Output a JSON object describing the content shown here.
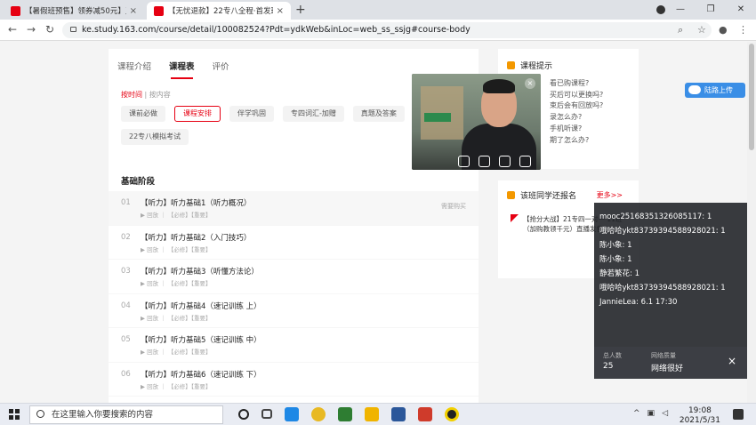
{
  "browser": {
    "tabs": [
      {
        "title": "【暑假班预售】领券减50元】丑",
        "active": false
      },
      {
        "title": "【无忧退款】22专八全程·首发班",
        "active": true
      }
    ],
    "new_tab": "+",
    "url": "ke.study.163.com/course/detail/100082524?Pdt=ydkWeb&inLoc=web_ss_ssjg#course-body"
  },
  "course": {
    "tabs": [
      {
        "label": "课程介绍",
        "active": false
      },
      {
        "label": "课程表",
        "active": true
      },
      {
        "label": "评价",
        "active": false
      }
    ],
    "sort": {
      "time": "按时间",
      "sep": "|",
      "content": "按内容"
    },
    "chips": [
      {
        "label": "课前必做",
        "selected": false
      },
      {
        "label": "课程安排",
        "selected": true
      },
      {
        "label": "伴学巩固",
        "selected": false
      },
      {
        "label": "专四词汇-加赠",
        "selected": false
      },
      {
        "label": "真题及答案",
        "selected": false
      },
      {
        "label": "22专八模拟考试",
        "selected": false
      }
    ],
    "section_title": "基础阶段",
    "lessons": [
      {
        "num": "01",
        "title": "【听力】听力基础1（听力概况）",
        "meta": "▶ 回放 ｜ 【必修】【重要】",
        "right": "需要购买"
      },
      {
        "num": "02",
        "title": "【听力】听力基础2（入门技巧）",
        "meta": "▶ 回放 ｜ 【必修】【重要】",
        "right": ""
      },
      {
        "num": "03",
        "title": "【听力】听力基础3（听懂方法论）",
        "meta": "▶ 回放 ｜ 【必修】【重要】",
        "right": ""
      },
      {
        "num": "04",
        "title": "【听力】听力基础4（速记训练 上）",
        "meta": "▶ 回放 ｜ 【必修】【重要】",
        "right": ""
      },
      {
        "num": "05",
        "title": "【听力】听力基础5（速记训练 中）",
        "meta": "▶ 回放 ｜ 【必修】【重要】",
        "right": ""
      },
      {
        "num": "06",
        "title": "【听力】听力基础6（速记训练 下）",
        "meta": "▶ 回放 ｜ 【必修】【重要】",
        "right": ""
      }
    ]
  },
  "sidebar": {
    "tips_title": "课程提示",
    "faq": [
      "看已购课程?",
      "买后可以更换吗?",
      "束后会有回放吗?",
      "录怎么办?",
      "手机听课?",
      "期了怎么办?"
    ],
    "enroll_title": "该班同学还报名",
    "more": "更多>>",
    "promo": "【抢分大战】21专四一对一·11班（加购教领千元）直播发售..."
  },
  "cloud_button": "陆路上传",
  "chat": {
    "messages": [
      "mooc25168351326085117: 1",
      "哦哈哈ykt83739394588928021: 1",
      "陈小象: 1",
      "陈小象: 1",
      "静若繁花: 1",
      "哦哈哈ykt83739394588928021: 1",
      "JannieLea: 6.1 17:30"
    ],
    "total_label": "总人数",
    "total_value": "25",
    "net_label": "网络质量",
    "net_value": "网络很好",
    "close": "×"
  },
  "taskbar": {
    "search_placeholder": "在这里输入你要搜索的内容",
    "time": "19:08",
    "date": "2021/5/31",
    "app_colors": [
      "#222222",
      "#2b6bd6",
      "#1e88e5",
      "#e8b923",
      "#2e7d32",
      "#f0b400",
      "#2b579a",
      "#cf3b2b",
      "#f2d000"
    ]
  },
  "colors": {
    "accent": "#e60012",
    "chat_bg": "#1e2024",
    "cloud": "#3a8ee6"
  }
}
